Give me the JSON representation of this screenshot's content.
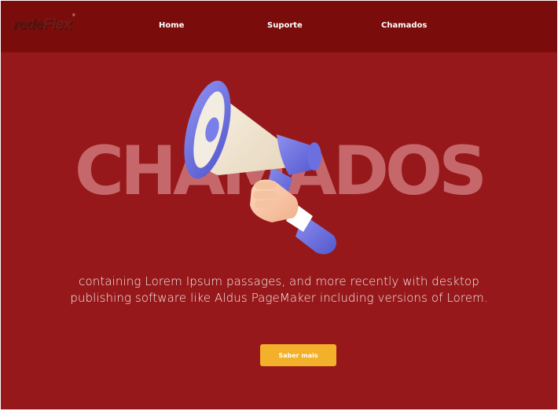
{
  "brand": {
    "logo_text_a": "rede",
    "logo_text_b": "Flex",
    "logo_mark": "®"
  },
  "nav": {
    "items": [
      {
        "label": "Home"
      },
      {
        "label": "Suporte"
      },
      {
        "label": "Chamados"
      }
    ]
  },
  "hero": {
    "title": "CHAMADOS",
    "description": "containing Lorem Ipsum passages, and more recently with desktop publishing software like Aldus PageMaker including versions of Lorem.",
    "cta_label": "Saber mais",
    "illustration_icon": "megaphone-icon"
  },
  "colors": {
    "navbar": "#7a0d0b",
    "background": "#96181a",
    "title": "#c6686b",
    "cta": "#f2b02b"
  }
}
